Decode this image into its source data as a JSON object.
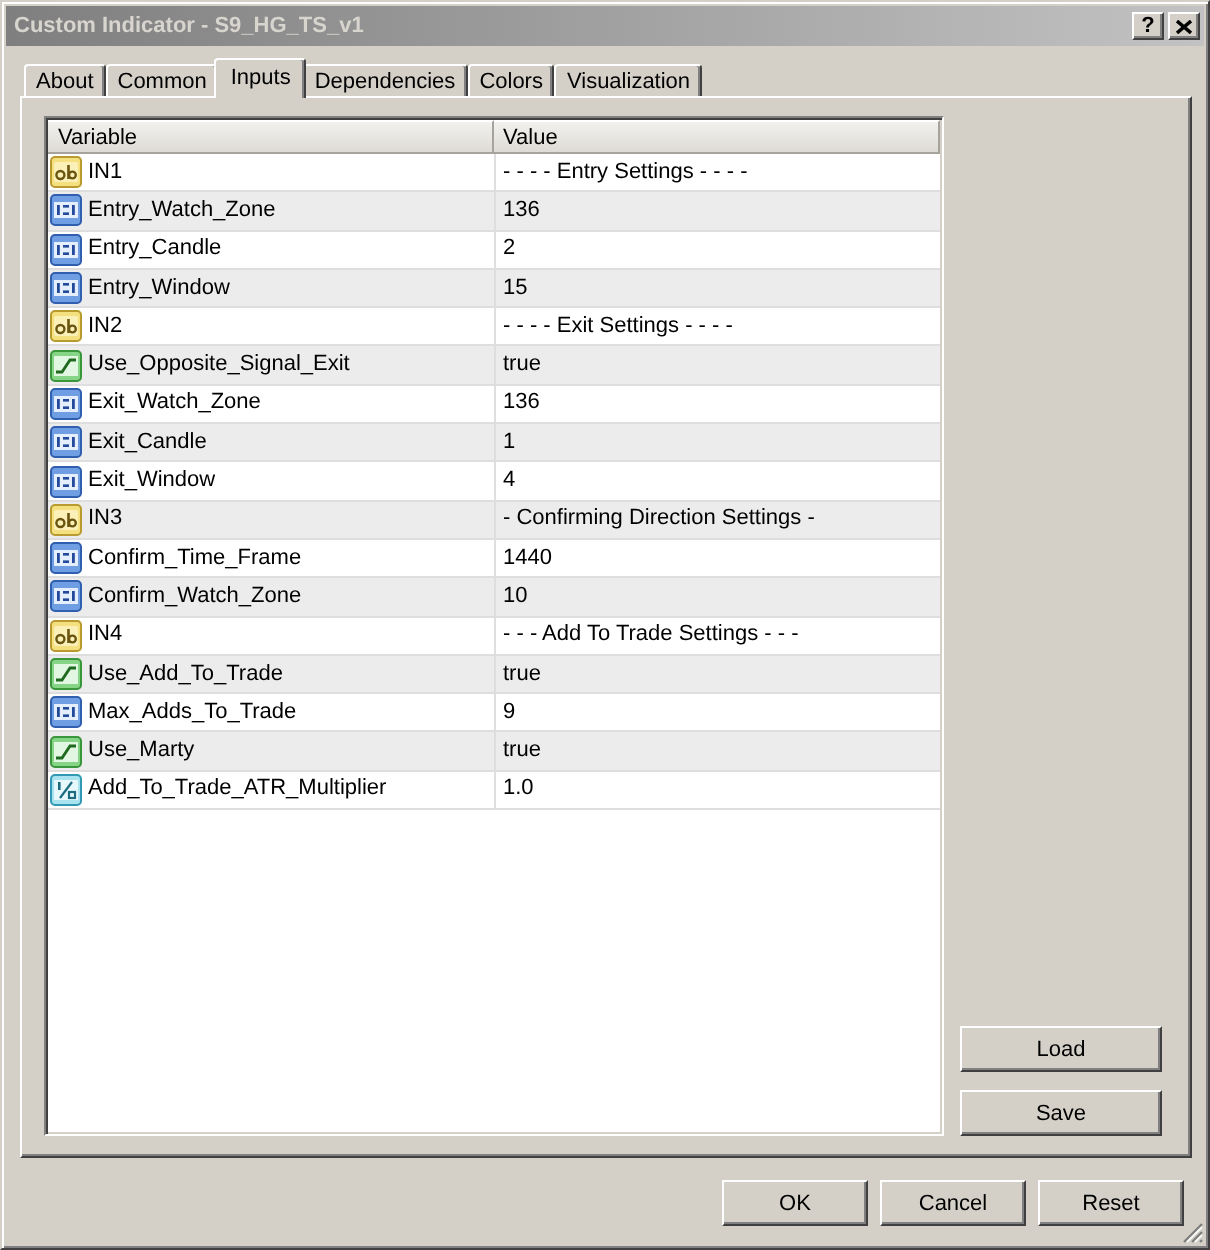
{
  "window": {
    "title": "Custom Indicator - S9_HG_TS_v1",
    "help_button": "?"
  },
  "tabs": [
    {
      "label": "About",
      "selected": false
    },
    {
      "label": "Common",
      "selected": false
    },
    {
      "label": "Inputs",
      "selected": true
    },
    {
      "label": "Dependencies",
      "selected": false
    },
    {
      "label": "Colors",
      "selected": false
    },
    {
      "label": "Visualization",
      "selected": false
    }
  ],
  "table": {
    "columns": [
      "Variable",
      "Value"
    ],
    "rows": [
      {
        "kind": "string",
        "variable": "IN1",
        "value": "- - - - Entry Settings - - - -"
      },
      {
        "kind": "int",
        "variable": "Entry_Watch_Zone",
        "value": "136"
      },
      {
        "kind": "int",
        "variable": "Entry_Candle",
        "value": "2"
      },
      {
        "kind": "int",
        "variable": "Entry_Window",
        "value": "15"
      },
      {
        "kind": "string",
        "variable": "IN2",
        "value": "- - - - Exit Settings - - - -"
      },
      {
        "kind": "bool",
        "variable": "Use_Opposite_Signal_Exit",
        "value": "true"
      },
      {
        "kind": "int",
        "variable": "Exit_Watch_Zone",
        "value": "136"
      },
      {
        "kind": "int",
        "variable": "Exit_Candle",
        "value": "1"
      },
      {
        "kind": "int",
        "variable": "Exit_Window",
        "value": "4"
      },
      {
        "kind": "string",
        "variable": "IN3",
        "value": "- Confirming Direction Settings -"
      },
      {
        "kind": "int",
        "variable": "Confirm_Time_Frame",
        "value": "1440"
      },
      {
        "kind": "int",
        "variable": "Confirm_Watch_Zone",
        "value": "10"
      },
      {
        "kind": "string",
        "variable": "IN4",
        "value": "- - - Add To Trade Settings - - -"
      },
      {
        "kind": "bool",
        "variable": "Use_Add_To_Trade",
        "value": "true"
      },
      {
        "kind": "int",
        "variable": "Max_Adds_To_Trade",
        "value": "9"
      },
      {
        "kind": "bool",
        "variable": "Use_Marty",
        "value": "true"
      },
      {
        "kind": "double",
        "variable": "Add_To_Trade_ATR_Multiplier",
        "value": "1.0"
      }
    ]
  },
  "side_buttons": [
    "Load",
    "Save"
  ],
  "buttons": [
    "OK",
    "Cancel",
    "Reset"
  ]
}
